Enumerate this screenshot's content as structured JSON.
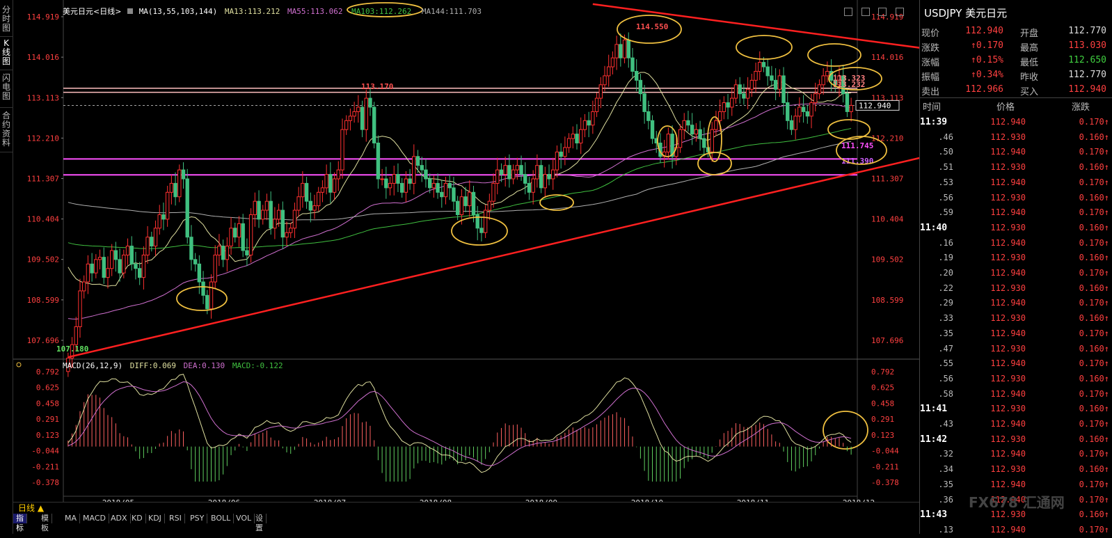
{
  "left_tabs": [
    "分时图",
    "K线图",
    "闪电图",
    "合约资料"
  ],
  "legend": {
    "series_name": "美元日元<日线>",
    "ma_label": "MA(13,55,103,144)",
    "ma13": "MA13:113.212",
    "ma55": "MA55:113.062",
    "ma103": "MA103:112.262",
    "ma144": "MA144:111.703"
  },
  "chart_data": {
    "type": "candlestick",
    "title": "美元日元<日线>",
    "y_ticks": [
      "114.919",
      "114.016",
      "113.113",
      "112.210",
      "111.307",
      "110.404",
      "109.502",
      "108.599",
      "107.696"
    ],
    "y_tick_values": [
      114.919,
      114.016,
      113.113,
      112.21,
      111.307,
      110.404,
      109.502,
      108.599,
      107.696
    ],
    "x_labels": [
      "2018/05",
      "2018/06",
      "2018/07",
      "2018/08",
      "2018/09",
      "2018/10",
      "2018/11",
      "2018/12"
    ],
    "current_price": "112.940",
    "annotations": {
      "high": "114.550",
      "low": "107.180",
      "mid_high": "113.170",
      "levels": [
        "113.323",
        "113.232",
        "111.745",
        "111.390"
      ]
    },
    "horizontal_levels": [
      113.323,
      113.232,
      111.745,
      111.39
    ],
    "trend_lines": [
      {
        "name": "support",
        "from": [
          0,
          107.32
        ],
        "to": [
          234,
          112.25
        ]
      },
      {
        "name": "resistance",
        "from": [
          132,
          115.2
        ],
        "to": [
          234,
          113.95
        ]
      }
    ],
    "closes": [
      107.3,
      107.6,
      108.0,
      108.8,
      109.0,
      109.4,
      109.2,
      109.5,
      109.55,
      109.1,
      109.3,
      109.7,
      109.5,
      109.2,
      109.6,
      109.8,
      109.4,
      109.3,
      109.1,
      109.6,
      110.0,
      109.8,
      110.2,
      110.5,
      110.4,
      111.0,
      111.2,
      110.9,
      111.5,
      111.3,
      110.0,
      109.5,
      109.4,
      109.0,
      108.7,
      108.4,
      109.0,
      109.6,
      109.8,
      109.5,
      109.8,
      110.2,
      110.0,
      110.3,
      109.7,
      109.6,
      110.5,
      110.8,
      110.4,
      110.6,
      110.8,
      110.2,
      110.4,
      110.6,
      110.0,
      110.1,
      110.2,
      110.6,
      110.9,
      111.2,
      110.8,
      110.6,
      110.7,
      111.0,
      111.1,
      111.4,
      111.0,
      111.3,
      111.5,
      112.4,
      112.6,
      112.7,
      112.8,
      112.9,
      112.4,
      113.1,
      112.9,
      112.1,
      111.3,
      111.3,
      111.1,
      111.2,
      111.4,
      111.2,
      111.0,
      111.3,
      111.2,
      111.8,
      111.6,
      111.5,
      111.3,
      111.1,
      111.2,
      111.0,
      110.9,
      111.2,
      111.1,
      110.8,
      110.5,
      110.9,
      110.7,
      111.0,
      110.5,
      110.2,
      110.1,
      110.6,
      110.8,
      111.2,
      111.5,
      111.4,
      111.6,
      111.3,
      111.5,
      111.6,
      111.4,
      111.2,
      111.0,
      111.3,
      111.6,
      111.1,
      111.4,
      111.3,
      111.5,
      111.9,
      111.8,
      112.0,
      112.2,
      112.3,
      112.1,
      112.4,
      112.6,
      112.5,
      112.8,
      113.1,
      113.4,
      113.6,
      113.8,
      114.0,
      114.3,
      114.0,
      114.4,
      114.0,
      113.7,
      113.5,
      113.2,
      112.8,
      112.6,
      112.2,
      112.1,
      111.8,
      111.9,
      112.3,
      111.8,
      112.0,
      112.4,
      112.6,
      112.5,
      112.3,
      112.4,
      112.2,
      112.0,
      111.9,
      112.4,
      112.6,
      112.8,
      113.0,
      112.9,
      113.1,
      113.4,
      113.2,
      113.1,
      113.3,
      113.5,
      113.7,
      113.9,
      113.8,
      113.6,
      113.5,
      113.3,
      113.6,
      113.0,
      112.6,
      112.4,
      112.7,
      112.9,
      112.8,
      112.7,
      113.0,
      113.2,
      113.4,
      113.6,
      113.7,
      113.5,
      113.4,
      113.6,
      113.2,
      112.8,
      112.94
    ],
    "series": [
      {
        "name": "MA13",
        "color": "#e0e0a0"
      },
      {
        "name": "MA55",
        "color": "#d070d0"
      },
      {
        "name": "MA103",
        "color": "#40c040"
      },
      {
        "name": "MA144",
        "color": "#b0b0b0"
      }
    ],
    "macd": {
      "label": "MACD(26,12,9)",
      "diff": "DIFF:0.069",
      "dea": "DEA:0.130",
      "macd": "MACD:-0.122",
      "y_ticks": [
        "0.792",
        "0.625",
        "0.458",
        "0.291",
        "0.123",
        "-0.044",
        "-0.211",
        "-0.378"
      ],
      "y_tick_values": [
        0.792,
        0.625,
        0.458,
        0.291,
        0.123,
        -0.044,
        -0.211,
        -0.378
      ]
    }
  },
  "bottom": {
    "period_label": "日线 ▲",
    "buttons": [
      "指标",
      "模板",
      "MA",
      "MACD",
      "ADX",
      "KD",
      "KDJ",
      "RSI",
      "PSY",
      "BOLL",
      "VOL",
      "设置"
    ]
  },
  "panel": {
    "title": "USDJPY 美元日元",
    "quote": [
      {
        "label": "现价",
        "value": "112.940",
        "color": "#ff4040"
      },
      {
        "label": "开盘",
        "value": "112.770",
        "color": "#dddddd"
      },
      {
        "label": "涨跌",
        "value": "↑0.170",
        "color": "#ff4040"
      },
      {
        "label": "最高",
        "value": "113.030",
        "color": "#ff4040"
      },
      {
        "label": "涨幅",
        "value": "↑0.15%",
        "color": "#ff4040"
      },
      {
        "label": "最低",
        "value": "112.650",
        "color": "#40d040"
      },
      {
        "label": "振幅",
        "value": "↑0.34%",
        "color": "#ff4040"
      },
      {
        "label": "昨收",
        "value": "112.770",
        "color": "#dddddd"
      },
      {
        "label": "卖出",
        "value": "112.966",
        "color": "#ff4040"
      },
      {
        "label": "买入",
        "value": "112.940",
        "color": "#ff4040"
      }
    ],
    "table_headers": [
      "时间",
      "价格",
      "涨跌"
    ],
    "ticks": [
      {
        "t": "11:39",
        "p": "112.940",
        "c": "0.170↑",
        "major": true
      },
      {
        "t": ".46",
        "p": "112.930",
        "c": "0.160↑"
      },
      {
        "t": ".50",
        "p": "112.940",
        "c": "0.170↑"
      },
      {
        "t": ".51",
        "p": "112.930",
        "c": "0.160↑"
      },
      {
        "t": ".53",
        "p": "112.940",
        "c": "0.170↑"
      },
      {
        "t": ".56",
        "p": "112.930",
        "c": "0.160↑"
      },
      {
        "t": ".59",
        "p": "112.940",
        "c": "0.170↑"
      },
      {
        "t": "11:40",
        "p": "112.930",
        "c": "0.160↑",
        "major": true
      },
      {
        "t": ".16",
        "p": "112.940",
        "c": "0.170↑"
      },
      {
        "t": ".19",
        "p": "112.930",
        "c": "0.160↑"
      },
      {
        "t": ".20",
        "p": "112.940",
        "c": "0.170↑"
      },
      {
        "t": ".22",
        "p": "112.930",
        "c": "0.160↑"
      },
      {
        "t": ".29",
        "p": "112.940",
        "c": "0.170↑"
      },
      {
        "t": ".33",
        "p": "112.930",
        "c": "0.160↑"
      },
      {
        "t": ".35",
        "p": "112.940",
        "c": "0.170↑"
      },
      {
        "t": ".47",
        "p": "112.930",
        "c": "0.160↑"
      },
      {
        "t": ".55",
        "p": "112.940",
        "c": "0.170↑"
      },
      {
        "t": ".56",
        "p": "112.930",
        "c": "0.160↑"
      },
      {
        "t": ".58",
        "p": "112.940",
        "c": "0.170↑"
      },
      {
        "t": "11:41",
        "p": "112.930",
        "c": "0.160↑",
        "major": true
      },
      {
        "t": ".43",
        "p": "112.940",
        "c": "0.170↑"
      },
      {
        "t": "11:42",
        "p": "112.930",
        "c": "0.160↑",
        "major": true
      },
      {
        "t": ".32",
        "p": "112.940",
        "c": "0.170↑"
      },
      {
        "t": ".34",
        "p": "112.930",
        "c": "0.160↑"
      },
      {
        "t": ".35",
        "p": "112.940",
        "c": "0.170↑"
      },
      {
        "t": ".36",
        "p": "112.940",
        "c": "0.170↑"
      },
      {
        "t": "11:43",
        "p": "112.930",
        "c": "0.160↑",
        "major": true
      },
      {
        "t": ".13",
        "p": "112.940",
        "c": "0.170↑"
      }
    ],
    "watermark": "FX678 汇通网"
  }
}
